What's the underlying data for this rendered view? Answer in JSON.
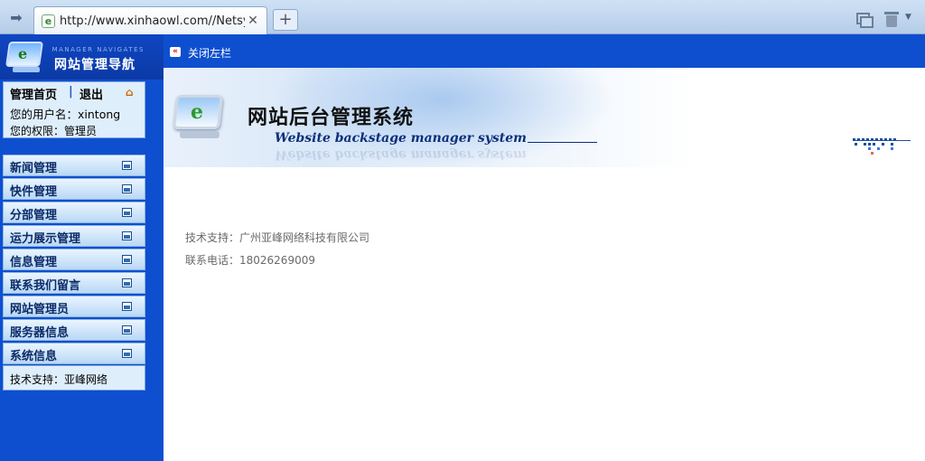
{
  "browser": {
    "tab_url": "http://www.xinhaowl.com//Netsys...",
    "favicon_letter": "e"
  },
  "sidebar": {
    "logo_subtitle": "MANAGER NAVIGATES",
    "logo_title": "网站管理导航",
    "home_label": "管理首页",
    "separator": "|",
    "logout_label": "退出",
    "username_text": "您的用户名：xintong",
    "permission_text": "您的权限：管理员",
    "menu": [
      {
        "label": "新闻管理"
      },
      {
        "label": "快件管理"
      },
      {
        "label": "分部管理"
      },
      {
        "label": "运力展示管理"
      },
      {
        "label": "信息管理"
      },
      {
        "label": "联系我们留言"
      },
      {
        "label": "网站管理员"
      },
      {
        "label": "服务器信息"
      },
      {
        "label": "系统信息"
      }
    ],
    "support_text": "技术支持：亚峰网络"
  },
  "content": {
    "collapse_label": "关闭左栏",
    "banner_title": "网站后台管理系统",
    "banner_subtitle": "Website backstage manager system",
    "banner_icon_letter": "e",
    "support_line": "技术支持：广州亚峰网络科技有限公司",
    "phone_line": "联系电话：18026269009"
  },
  "colors": {
    "sidebar_blue": "#0e4fd0",
    "banner_text": "#0c2f7a",
    "info_text": "#6a6a6a"
  }
}
